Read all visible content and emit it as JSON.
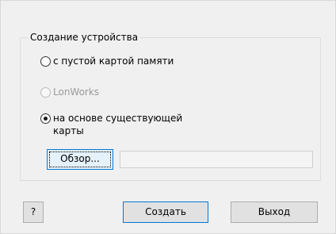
{
  "group": {
    "title": "Создание устройства"
  },
  "options": [
    {
      "label": "с пустой картой памяти",
      "checked": false,
      "disabled": false
    },
    {
      "label": "LonWorks",
      "checked": false,
      "disabled": true
    },
    {
      "label": "на основе существующей карты",
      "checked": true,
      "disabled": false
    }
  ],
  "browse": {
    "label": "Обзор...",
    "path_value": ""
  },
  "footer": {
    "help_label": "?",
    "create_label": "Создать",
    "exit_label": "Выход"
  }
}
